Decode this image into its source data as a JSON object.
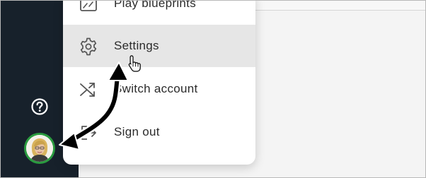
{
  "menu": {
    "items": [
      {
        "label": "Play blueprints",
        "icon": "blueprint-icon"
      },
      {
        "label": "Settings",
        "icon": "gear-icon",
        "active": true
      },
      {
        "label": "Switch account",
        "icon": "shuffle-icon"
      },
      {
        "label": "Sign out",
        "icon": "sign-out-icon"
      }
    ]
  },
  "sidebar": {
    "help_icon": "help-icon",
    "avatar": "user-avatar"
  },
  "colors": {
    "sidebar": "#17212b",
    "active_item": "#e6e6e6",
    "avatar_ring": "#2a9b3f",
    "arrow": "#000000"
  }
}
